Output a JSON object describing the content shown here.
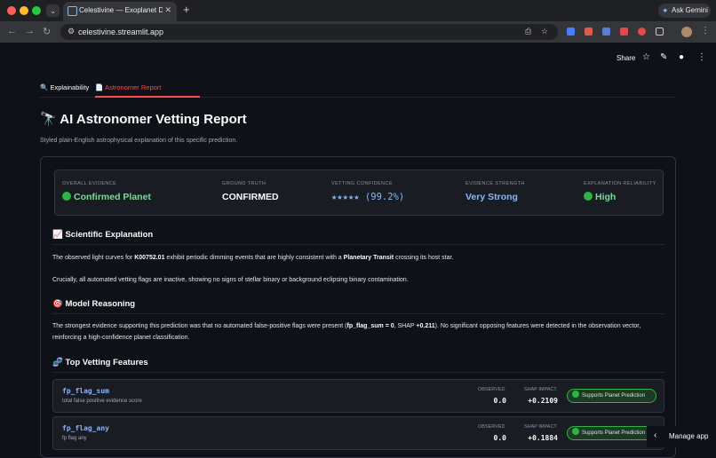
{
  "browser": {
    "tab_title": "Celestivine — Exoplanet Disc",
    "url": "celestivine.streamlit.app",
    "ask_gemini": "Ask Gemini",
    "new_tab": "+"
  },
  "header": {
    "share": "Share"
  },
  "tabs": [
    {
      "icon": "🔍",
      "label": "Explainability"
    },
    {
      "icon": "📄",
      "label": "Astronomer Report"
    }
  ],
  "report": {
    "title": "🔭 AI Astronomer Vetting Report",
    "caption": "Styled plain-English astrophysical explanation of this specific prediction.",
    "metrics": {
      "overall_evidence": {
        "label": "OVERALL EVIDENCE",
        "value": "Confirmed Planet"
      },
      "ground_truth": {
        "label": "GROUND TRUTH",
        "value": "CONFIRMED"
      },
      "vetting_confidence": {
        "label": "VETTING CONFIDENCE",
        "value": "★★★★★ (99.2%)"
      },
      "evidence_strength": {
        "label": "EVIDENCE STRENGTH",
        "value": "Very Strong"
      },
      "explanation_reliability": {
        "label": "EXPLANATION RELIABILITY",
        "value": "High"
      }
    },
    "scientific_explanation": {
      "title": "📈 Scientific Explanation",
      "p1_pre": "The observed light curves for ",
      "p1_obj": "K00752.01",
      "p1_mid": " exhibit periodic dimming events that are highly consistent with a ",
      "p1_bold": "Planetary Transit",
      "p1_post": " crossing its host star.",
      "p2": "Crucially, all automated vetting flags are inactive, showing no signs of stellar binary or background eclipsing binary contamination."
    },
    "model_reasoning": {
      "title": "🎯 Model Reasoning",
      "pre": "The strongest evidence supporting this prediction was that no automated false-positive flags were present (",
      "bold1": "fp_flag_sum = 0",
      "mid": ", SHAP ",
      "bold2": "+0.211",
      "post": "). No significant opposing features were detected in the observation vector, reinforcing a high-confidence planet classification."
    },
    "top_features": {
      "title": "🧬 Top Vetting Features",
      "observed_label": "OBSERVED",
      "shap_label": "SHAP IMPACT",
      "items": [
        {
          "name": "fp_flag_sum",
          "desc": "total false positive evidence score",
          "observed": "0.0",
          "shap": "+0.2109",
          "badge": "Supports Planet Prediction"
        },
        {
          "name": "fp_flag_any",
          "desc": "fp flag any",
          "observed": "0.0",
          "shap": "+0.1884",
          "badge": "Supports Planet Prediction"
        }
      ]
    }
  },
  "manage_app": "Manage app"
}
